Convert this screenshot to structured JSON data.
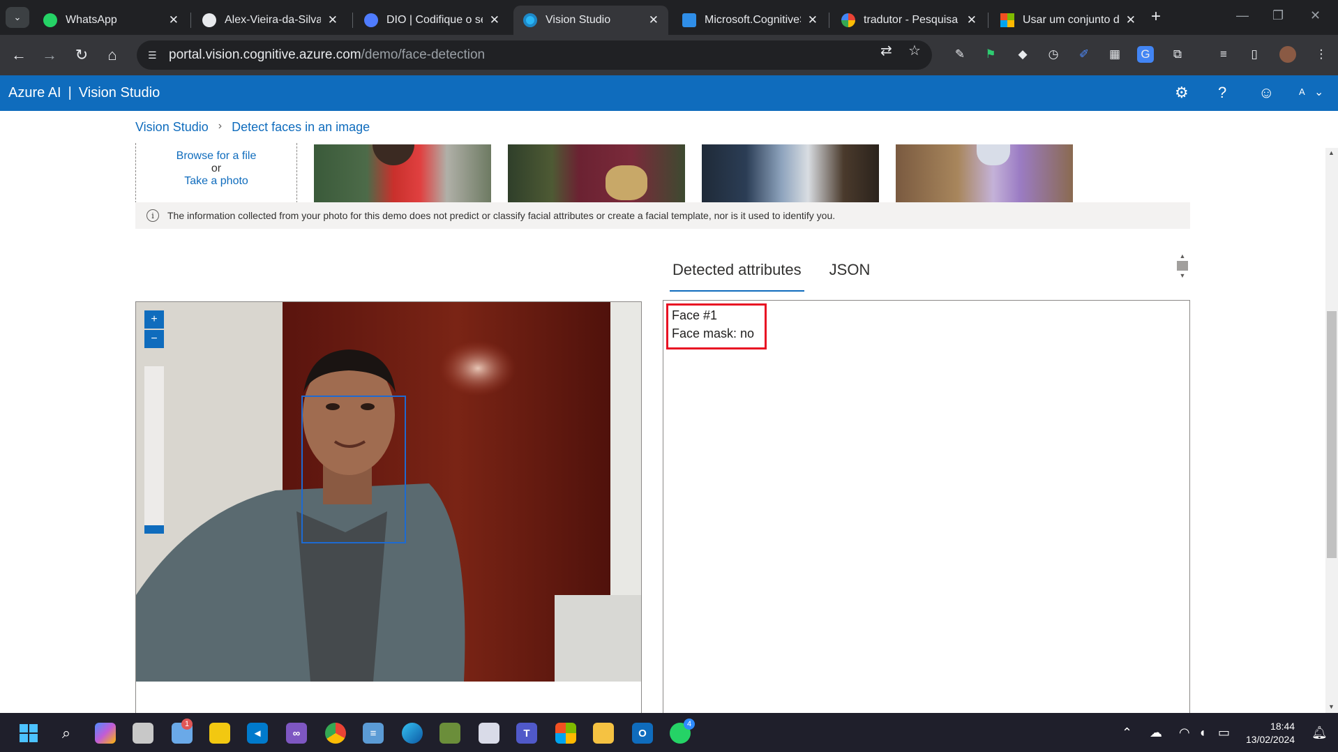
{
  "browser": {
    "tabs": [
      {
        "title": "WhatsApp",
        "icon": "whatsapp-icon",
        "color": "#25d366",
        "active": false
      },
      {
        "title": "Alex-Vieira-da-Silva (",
        "icon": "github-icon",
        "color": "#ffffff",
        "active": false
      },
      {
        "title": "DIO | Codifique o seu",
        "icon": "dio-icon",
        "color": "#4f7cff",
        "active": false
      },
      {
        "title": "Vision Studio",
        "icon": "vision-studio-icon",
        "color": "#29b6f6",
        "active": true
      },
      {
        "title": "Microsoft.CognitiveS",
        "icon": "azure-icon",
        "color": "#2f8ee8",
        "active": false
      },
      {
        "title": "tradutor - Pesquisa G",
        "icon": "google-icon",
        "color": "#ffffff",
        "active": false
      },
      {
        "title": "Usar um conjunto de",
        "icon": "microsoft-icon",
        "color": "#f25022",
        "active": false
      }
    ],
    "url_host": "portal.vision.cognitive.azure.com",
    "url_path": "/demo/face-detection"
  },
  "header": {
    "brand": "Azure AI",
    "product": "Vision Studio",
    "avatar_letter": "A"
  },
  "breadcrumb": {
    "root": "Vision Studio",
    "current": "Detect faces in an image"
  },
  "upload": {
    "browse": "Browse for a file",
    "or": "or",
    "take_photo": "Take a photo"
  },
  "info": {
    "text": "The information collected from your photo for this demo does not predict or classify facial attributes or create a facial template, nor is it used to identify you."
  },
  "results": {
    "tabs": [
      "Detected attributes",
      "JSON"
    ],
    "active_tab": "Detected attributes",
    "face_label": "Face #1",
    "mask_label": "Face mask: no"
  },
  "taskbar": {
    "whatsapp_badge": "4",
    "weather_badge": "1",
    "time": "18:44",
    "date": "13/02/2024"
  },
  "colors": {
    "azure_blue": "#0f6cbd",
    "highlight_red": "#e81123"
  }
}
